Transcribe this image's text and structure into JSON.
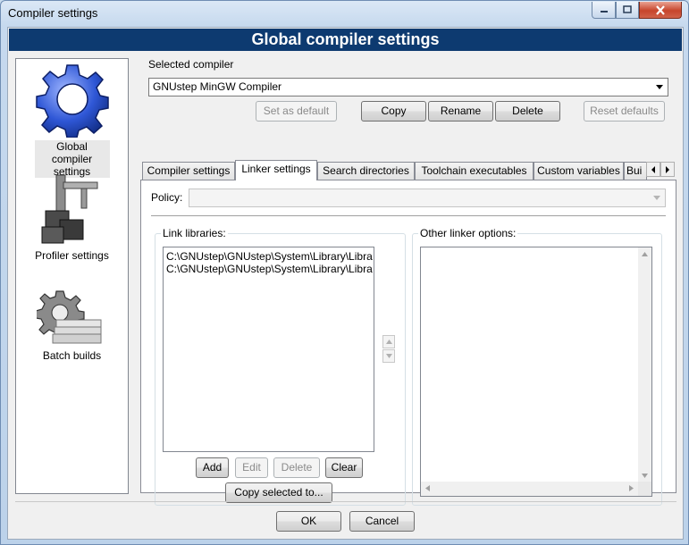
{
  "window": {
    "title": "Compiler settings"
  },
  "banner": {
    "title": "Global compiler settings"
  },
  "nav": {
    "items": [
      {
        "label": "Global compiler settings",
        "icon": "gear-icon"
      },
      {
        "label": "Profiler settings",
        "icon": "profiler-icon"
      },
      {
        "label": "Batch builds",
        "icon": "batch-builds-icon"
      }
    ]
  },
  "compiler": {
    "label": "Selected compiler",
    "value": "GNUstep MinGW Compiler",
    "buttons": {
      "set_default": "Set as default",
      "copy": "Copy",
      "rename": "Rename",
      "delete": "Delete",
      "reset_defaults": "Reset defaults"
    }
  },
  "tabs": [
    {
      "label": "Compiler settings"
    },
    {
      "label": "Linker settings"
    },
    {
      "label": "Search directories"
    },
    {
      "label": "Toolchain executables"
    },
    {
      "label": "Custom variables"
    },
    {
      "label": "Bui"
    }
  ],
  "linker": {
    "policy_label": "Policy:",
    "policy_value": "",
    "link_libraries_label": "Link libraries:",
    "link_libraries": [
      "C:\\GNUstep\\GNUstep\\System\\Library\\Libra",
      "C:\\GNUstep\\GNUstep\\System\\Library\\Libra"
    ],
    "buttons": {
      "add": "Add",
      "edit": "Edit",
      "delete": "Delete",
      "clear": "Clear",
      "copy_selected": "Copy selected to..."
    },
    "other_options_label": "Other linker options:",
    "other_options_value": ""
  },
  "footer": {
    "ok": "OK",
    "cancel": "Cancel"
  },
  "colors": {
    "banner": "#0d3a70",
    "window_chrome": "#c6d9ee"
  }
}
